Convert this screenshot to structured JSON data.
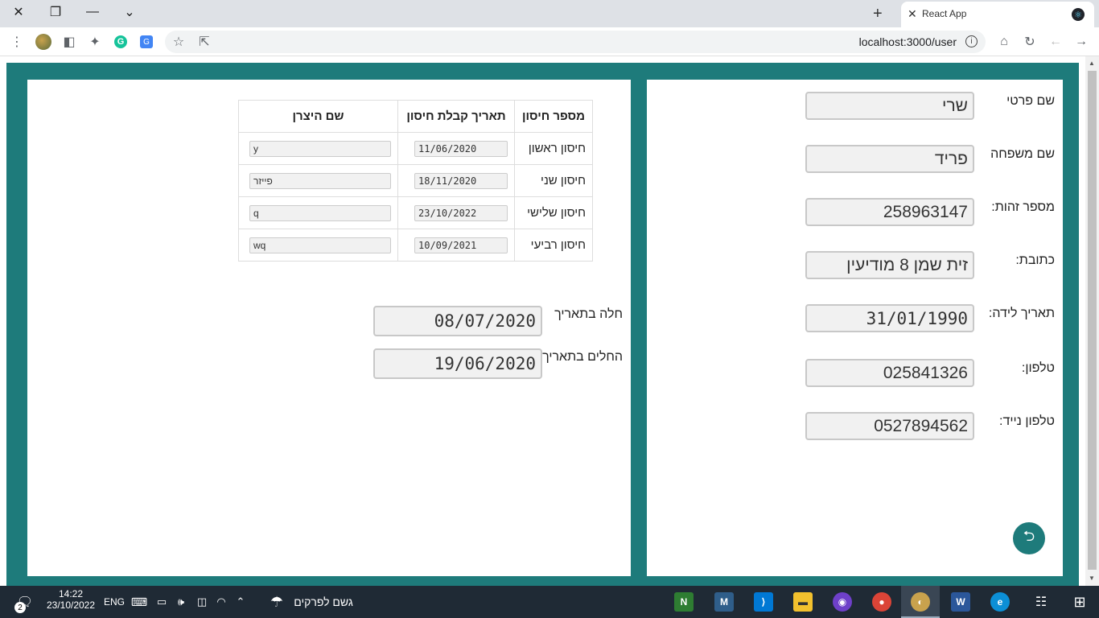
{
  "browser": {
    "tab_title": "React App",
    "url": "localhost:3000/user",
    "new_tab": "+",
    "close_tab": "✕"
  },
  "personal": {
    "first_name_label": "שם פרטי",
    "first_name_value": "שרי",
    "last_name_label": "שם משפחה",
    "last_name_value": "פריד",
    "id_label": "מספר זהות:",
    "id_value": "258963147",
    "address_label": "כתובת:",
    "address_value": "זית שמן 8 מודיעין",
    "birth_label": "תאריך לידה:",
    "birth_value": "31/01/1990",
    "phone_label": "טלפון:",
    "phone_value": "025841326",
    "mobile_label": "טלפון נייד:",
    "mobile_value": "0527894562"
  },
  "vaccines": {
    "headers": [
      "מספר חיסון",
      "תאריך קבלת חיסון",
      "שם היצרן"
    ],
    "rows": [
      {
        "name": "חיסון ראשון",
        "date": "11/06/2020",
        "maker": "y"
      },
      {
        "name": "חיסון שני",
        "date": "18/11/2020",
        "maker": "פייזר"
      },
      {
        "name": "חיסון שלישי",
        "date": "23/10/2022",
        "maker": "q"
      },
      {
        "name": "חיסון רביעי",
        "date": "10/09/2021",
        "maker": "wq"
      }
    ]
  },
  "illness": {
    "sick_label": "חלה בתאריך",
    "sick_value": "08/07/2020",
    "recovered_label": "החלים בתאריך",
    "recovered_value": "19/06/2020"
  },
  "taskbar": {
    "time": "14:22",
    "date": "23/10/2022",
    "lang": "ENG",
    "weather": "גשם לפרקים",
    "notifications": "2"
  }
}
